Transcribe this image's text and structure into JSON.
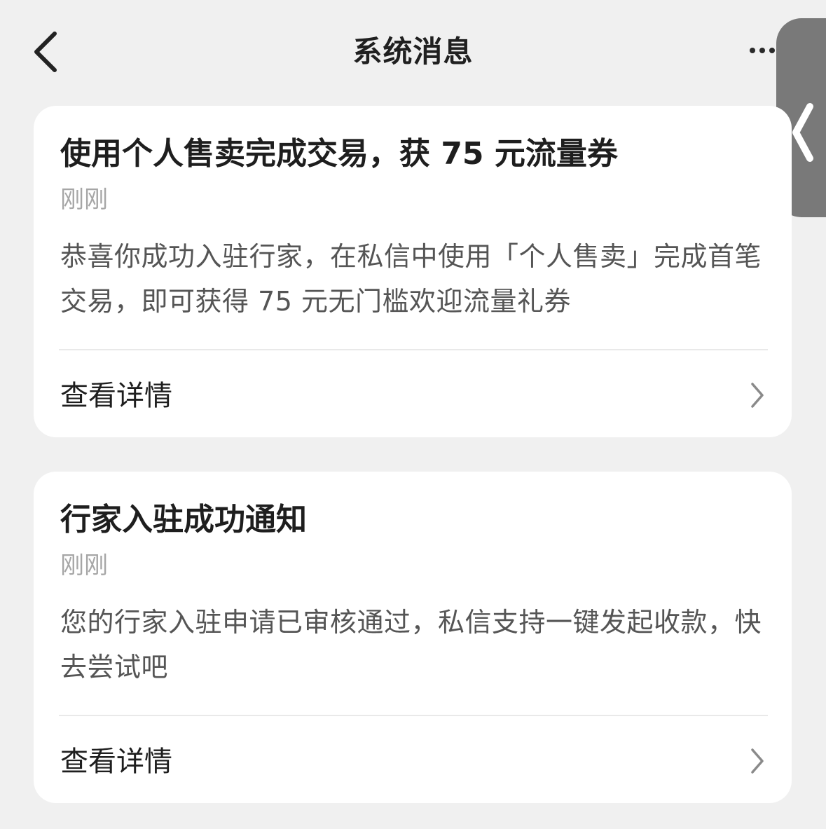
{
  "header": {
    "title": "系统消息",
    "back_icon": "chevron-left-icon",
    "more_icon": "more-horizontal-icon"
  },
  "side_handle": {
    "icon": "chevron-left-icon"
  },
  "messages": [
    {
      "title": "使用个人售卖完成交易，获 75 元流量券",
      "time": "刚刚",
      "body": "恭喜你成功入驻行家，在私信中使用「个人售卖」完成首笔交易，即可获得 75 元无门槛欢迎流量礼券",
      "link_label": "查看详情",
      "link_icon": "chevron-right-icon"
    },
    {
      "title": "行家入驻成功通知",
      "time": "刚刚",
      "body": "您的行家入驻申请已审核通过，私信支持一键发起收款，快去尝试吧",
      "link_label": "查看详情",
      "link_icon": "chevron-right-icon"
    }
  ],
  "colors": {
    "background": "#f0f0f0",
    "card": "#ffffff",
    "title_text": "#1e1e1e",
    "body_text": "#555555",
    "time_text": "#a6a6a6",
    "divider": "#e9e9e9",
    "side_handle": "#797979"
  }
}
